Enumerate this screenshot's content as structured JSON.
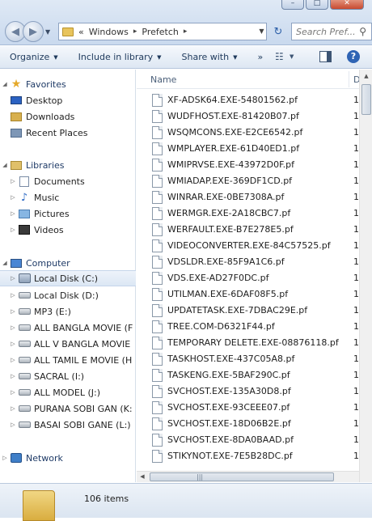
{
  "window": {
    "min_glyph": "–",
    "max_glyph": "□",
    "close_glyph": "✕"
  },
  "address": {
    "prefix": "«",
    "crumbs": [
      "Windows",
      "Prefetch"
    ],
    "separator": "▸"
  },
  "search": {
    "placeholder": "Search Pref..."
  },
  "commands": {
    "organize": "Organize",
    "include_in_library": "Include in library",
    "share_with": "Share with",
    "more": "»"
  },
  "nav": {
    "favorites": {
      "label": "Favorites",
      "items": [
        "Desktop",
        "Downloads",
        "Recent Places"
      ]
    },
    "libraries": {
      "label": "Libraries",
      "items": [
        "Documents",
        "Music",
        "Pictures",
        "Videos"
      ]
    },
    "computer": {
      "label": "Computer",
      "drives": [
        "Local Disk (C:)",
        "Local Disk (D:)",
        "MP3  (E:)",
        "ALL BANGLA MOVIE (F",
        "ALL V BANGLA MOVIE",
        "ALL TAMIL E MOVIE (H",
        "SACRAL  (I:)",
        "ALL MODEL  (J:)",
        "PURANA SOBI GAN  (K:",
        "BASAI  SOBI GANE  (L:)"
      ],
      "selected_index": 0
    },
    "network": {
      "label": "Network"
    }
  },
  "columns": {
    "name": "Name",
    "date": "D"
  },
  "files": [
    {
      "name": "XF-ADSK64.EXE-54801562.pf",
      "date": "1:"
    },
    {
      "name": "WUDFHOST.EXE-81420B07.pf",
      "date": "1:"
    },
    {
      "name": "WSQMCONS.EXE-E2CE6542.pf",
      "date": "1:"
    },
    {
      "name": "WMPLAYER.EXE-61D40ED1.pf",
      "date": "1:"
    },
    {
      "name": "WMIPRVSE.EXE-43972D0F.pf",
      "date": "1:"
    },
    {
      "name": "WMIADAP.EXE-369DF1CD.pf",
      "date": "1:"
    },
    {
      "name": "WINRAR.EXE-0BE7308A.pf",
      "date": "1:"
    },
    {
      "name": "WERMGR.EXE-2A18CBC7.pf",
      "date": "1:"
    },
    {
      "name": "WERFAULT.EXE-B7E278E5.pf",
      "date": "1:"
    },
    {
      "name": "VIDEOCONVERTER.EXE-84C57525.pf",
      "date": "1:"
    },
    {
      "name": "VDSLDR.EXE-85F9A1C6.pf",
      "date": "1:"
    },
    {
      "name": "VDS.EXE-AD27F0DC.pf",
      "date": "1:"
    },
    {
      "name": "UTILMAN.EXE-6DAF08F5.pf",
      "date": "1:"
    },
    {
      "name": "UPDATETASK.EXE-7DBAC29E.pf",
      "date": "1:"
    },
    {
      "name": "TREE.COM-D6321F44.pf",
      "date": "1:"
    },
    {
      "name": "TEMPORARY DELETE.EXE-08876118.pf",
      "date": "1:"
    },
    {
      "name": "TASKHOST.EXE-437C05A8.pf",
      "date": "1:"
    },
    {
      "name": "TASKENG.EXE-5BAF290C.pf",
      "date": "1:"
    },
    {
      "name": "SVCHOST.EXE-135A30D8.pf",
      "date": "1:"
    },
    {
      "name": "SVCHOST.EXE-93CEEE07.pf",
      "date": "1:"
    },
    {
      "name": "SVCHOST.EXE-18D06B2E.pf",
      "date": "1:"
    },
    {
      "name": "SVCHOST.EXE-8DA0BAAD.pf",
      "date": "1:"
    },
    {
      "name": "STIKYNOT.EXE-7E5B28DC.pf",
      "date": "1:"
    }
  ],
  "status": {
    "item_count": "106 items"
  }
}
